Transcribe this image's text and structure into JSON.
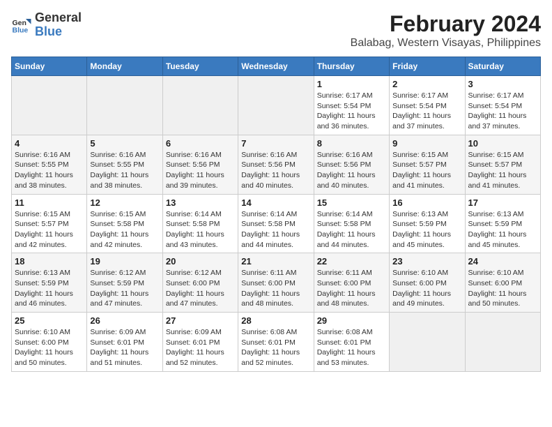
{
  "header": {
    "logo_general": "General",
    "logo_blue": "Blue",
    "title": "February 2024",
    "subtitle": "Balabag, Western Visayas, Philippines"
  },
  "days_of_week": [
    "Sunday",
    "Monday",
    "Tuesday",
    "Wednesday",
    "Thursday",
    "Friday",
    "Saturday"
  ],
  "weeks": [
    [
      {
        "day": "",
        "info": ""
      },
      {
        "day": "",
        "info": ""
      },
      {
        "day": "",
        "info": ""
      },
      {
        "day": "",
        "info": ""
      },
      {
        "day": "1",
        "info": "Sunrise: 6:17 AM\nSunset: 5:54 PM\nDaylight: 11 hours\nand 36 minutes."
      },
      {
        "day": "2",
        "info": "Sunrise: 6:17 AM\nSunset: 5:54 PM\nDaylight: 11 hours\nand 37 minutes."
      },
      {
        "day": "3",
        "info": "Sunrise: 6:17 AM\nSunset: 5:54 PM\nDaylight: 11 hours\nand 37 minutes."
      }
    ],
    [
      {
        "day": "4",
        "info": "Sunrise: 6:16 AM\nSunset: 5:55 PM\nDaylight: 11 hours\nand 38 minutes."
      },
      {
        "day": "5",
        "info": "Sunrise: 6:16 AM\nSunset: 5:55 PM\nDaylight: 11 hours\nand 38 minutes."
      },
      {
        "day": "6",
        "info": "Sunrise: 6:16 AM\nSunset: 5:56 PM\nDaylight: 11 hours\nand 39 minutes."
      },
      {
        "day": "7",
        "info": "Sunrise: 6:16 AM\nSunset: 5:56 PM\nDaylight: 11 hours\nand 40 minutes."
      },
      {
        "day": "8",
        "info": "Sunrise: 6:16 AM\nSunset: 5:56 PM\nDaylight: 11 hours\nand 40 minutes."
      },
      {
        "day": "9",
        "info": "Sunrise: 6:15 AM\nSunset: 5:57 PM\nDaylight: 11 hours\nand 41 minutes."
      },
      {
        "day": "10",
        "info": "Sunrise: 6:15 AM\nSunset: 5:57 PM\nDaylight: 11 hours\nand 41 minutes."
      }
    ],
    [
      {
        "day": "11",
        "info": "Sunrise: 6:15 AM\nSunset: 5:57 PM\nDaylight: 11 hours\nand 42 minutes."
      },
      {
        "day": "12",
        "info": "Sunrise: 6:15 AM\nSunset: 5:58 PM\nDaylight: 11 hours\nand 42 minutes."
      },
      {
        "day": "13",
        "info": "Sunrise: 6:14 AM\nSunset: 5:58 PM\nDaylight: 11 hours\nand 43 minutes."
      },
      {
        "day": "14",
        "info": "Sunrise: 6:14 AM\nSunset: 5:58 PM\nDaylight: 11 hours\nand 44 minutes."
      },
      {
        "day": "15",
        "info": "Sunrise: 6:14 AM\nSunset: 5:58 PM\nDaylight: 11 hours\nand 44 minutes."
      },
      {
        "day": "16",
        "info": "Sunrise: 6:13 AM\nSunset: 5:59 PM\nDaylight: 11 hours\nand 45 minutes."
      },
      {
        "day": "17",
        "info": "Sunrise: 6:13 AM\nSunset: 5:59 PM\nDaylight: 11 hours\nand 45 minutes."
      }
    ],
    [
      {
        "day": "18",
        "info": "Sunrise: 6:13 AM\nSunset: 5:59 PM\nDaylight: 11 hours\nand 46 minutes."
      },
      {
        "day": "19",
        "info": "Sunrise: 6:12 AM\nSunset: 5:59 PM\nDaylight: 11 hours\nand 47 minutes."
      },
      {
        "day": "20",
        "info": "Sunrise: 6:12 AM\nSunset: 6:00 PM\nDaylight: 11 hours\nand 47 minutes."
      },
      {
        "day": "21",
        "info": "Sunrise: 6:11 AM\nSunset: 6:00 PM\nDaylight: 11 hours\nand 48 minutes."
      },
      {
        "day": "22",
        "info": "Sunrise: 6:11 AM\nSunset: 6:00 PM\nDaylight: 11 hours\nand 48 minutes."
      },
      {
        "day": "23",
        "info": "Sunrise: 6:10 AM\nSunset: 6:00 PM\nDaylight: 11 hours\nand 49 minutes."
      },
      {
        "day": "24",
        "info": "Sunrise: 6:10 AM\nSunset: 6:00 PM\nDaylight: 11 hours\nand 50 minutes."
      }
    ],
    [
      {
        "day": "25",
        "info": "Sunrise: 6:10 AM\nSunset: 6:00 PM\nDaylight: 11 hours\nand 50 minutes."
      },
      {
        "day": "26",
        "info": "Sunrise: 6:09 AM\nSunset: 6:01 PM\nDaylight: 11 hours\nand 51 minutes."
      },
      {
        "day": "27",
        "info": "Sunrise: 6:09 AM\nSunset: 6:01 PM\nDaylight: 11 hours\nand 52 minutes."
      },
      {
        "day": "28",
        "info": "Sunrise: 6:08 AM\nSunset: 6:01 PM\nDaylight: 11 hours\nand 52 minutes."
      },
      {
        "day": "29",
        "info": "Sunrise: 6:08 AM\nSunset: 6:01 PM\nDaylight: 11 hours\nand 53 minutes."
      },
      {
        "day": "",
        "info": ""
      },
      {
        "day": "",
        "info": ""
      }
    ]
  ]
}
